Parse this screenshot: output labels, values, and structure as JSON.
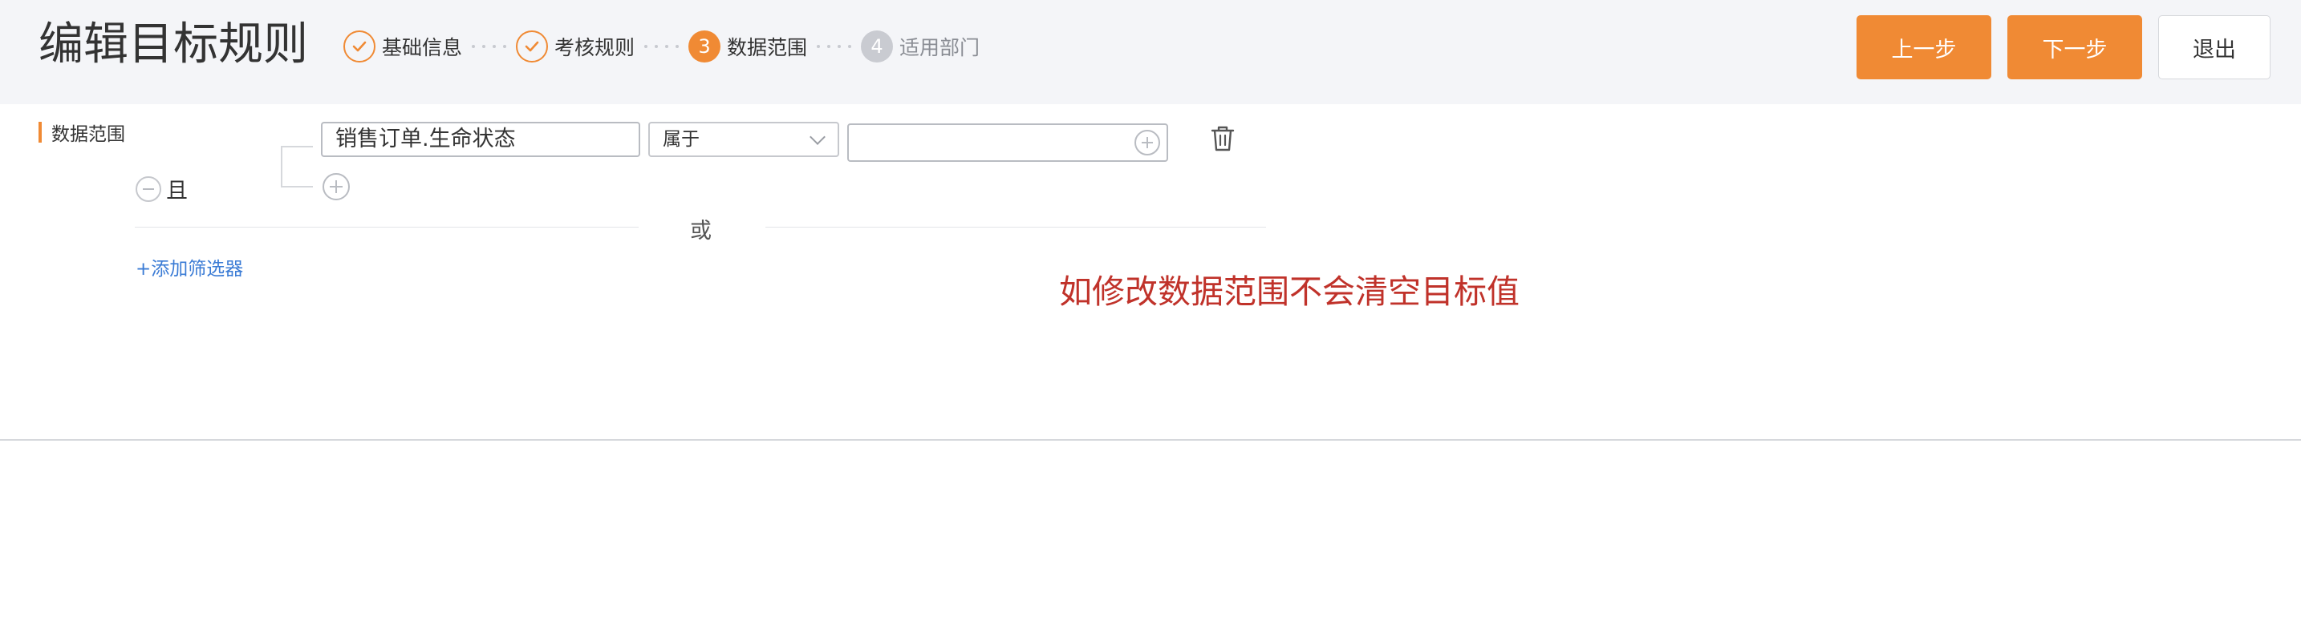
{
  "header": {
    "title": "编辑目标规则",
    "steps": [
      {
        "label": "基础信息",
        "state": "done"
      },
      {
        "label": "考核规则",
        "state": "done"
      },
      {
        "number": "3",
        "label": "数据范围",
        "state": "active"
      },
      {
        "number": "4",
        "label": "适用部门",
        "state": "pending"
      }
    ],
    "buttons": {
      "prev": "上一步",
      "next": "下一步",
      "exit": "退出"
    }
  },
  "main": {
    "section_label": "数据范围",
    "logic_and": "且",
    "condition": {
      "field": "销售订单.生命状态",
      "operator": "属于",
      "value": ""
    },
    "logic_or": "或",
    "add_filter": "+添加筛选器",
    "warning": "如修改数据范围不会清空目标值"
  },
  "colors": {
    "accent": "#f08a34",
    "link": "#3a7bd5",
    "warning": "#c0322a",
    "header_bg": "#f4f5f8"
  },
  "icons": {
    "step_done": "check-circle-icon",
    "remove_group": "minus-circle-icon",
    "add_condition": "plus-circle-icon",
    "value_add": "plus-circle-icon",
    "delete_condition": "trash-icon",
    "operator_dropdown": "chevron-down-icon"
  }
}
